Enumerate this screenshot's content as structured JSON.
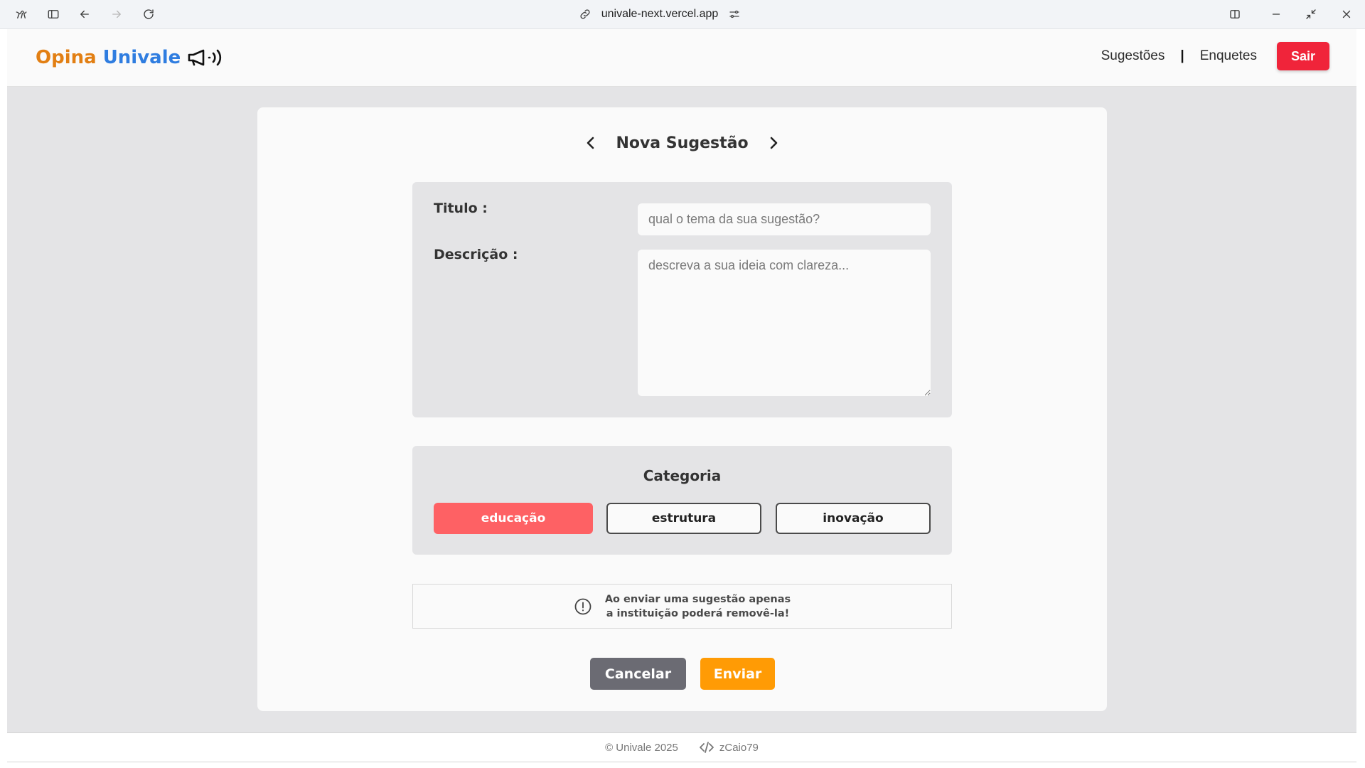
{
  "browser": {
    "url": "univale-next.vercel.app",
    "icons": [
      "app-logo-icon",
      "sidebar-toggle-icon",
      "back-arrow-icon",
      "forward-arrow-icon",
      "reload-icon",
      "link-icon",
      "site-settings-icon",
      "split-view-icon",
      "minimize-icon",
      "restore-icon",
      "close-icon"
    ]
  },
  "header": {
    "logo_part1": "Opina",
    "logo_part2": "Univale",
    "logo_icon": "megaphone-icon",
    "nav_suggestions": "Sugestões",
    "nav_separator": "|",
    "nav_polls": "Enquetes",
    "logout_label": "Sair"
  },
  "form": {
    "title": "Nova Sugestão",
    "title_label": "Titulo :",
    "title_placeholder": "qual o tema da sua sugestão?",
    "title_value": "",
    "description_label": "Descrição :",
    "description_placeholder": "descreva a sua ideia com clareza...",
    "description_value": "",
    "category": {
      "heading": "Categoria",
      "options": [
        "educação",
        "estrutura",
        "inovação"
      ],
      "selected": "educação"
    },
    "notice_line1": "Ao enviar uma sugestão apenas",
    "notice_line2": "a instituição poderá removê-la!",
    "cancel_label": "Cancelar",
    "submit_label": "Enviar"
  },
  "footer": {
    "copyright": "© Univale 2025",
    "author": "zCaio79"
  },
  "colors": {
    "logo_orange": "#e27f13",
    "logo_blue": "#2f7de0",
    "logout_red": "#f0243a",
    "selected_category": "#fe6164",
    "cancel_gray": "#6b6b73",
    "submit_orange": "#ff9b05",
    "page_background": "#e4e4e6"
  }
}
